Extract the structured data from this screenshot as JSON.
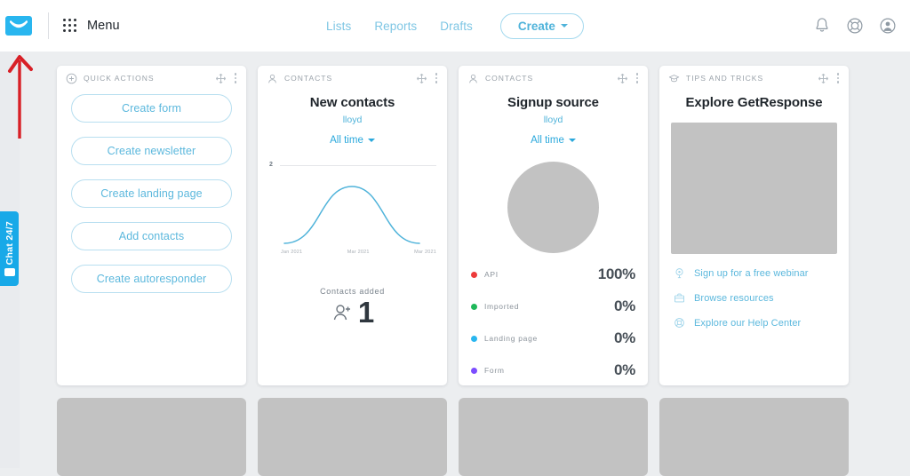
{
  "topbar": {
    "logo_icon": "envelope-icon",
    "logo_color": "#29b6ef",
    "menu_icon": "apps-grid-icon",
    "menu_label": "Menu",
    "nav_links": [
      {
        "label": "Lists"
      },
      {
        "label": "Reports"
      },
      {
        "label": "Drafts"
      }
    ],
    "create_label": "Create",
    "create_caret_icon": "chevron-down-icon",
    "right_icons": [
      {
        "name": "bell-icon"
      },
      {
        "name": "lifebuoy-icon"
      },
      {
        "name": "user-avatar-icon"
      }
    ]
  },
  "chat_widget": {
    "label": "Chat 24/7",
    "icon": "chat-bubble-icon",
    "color": "#18a9e8"
  },
  "annotation": {
    "arrow_icon": "red-up-arrow",
    "color": "#d81f26"
  },
  "cards": {
    "quick_actions": {
      "header_icon": "plus-circle-icon",
      "header_label": "Quick actions",
      "move_icon": "move-handle-icon",
      "menu_icon": "kebab-menu-icon",
      "buttons": [
        {
          "label": "Create form"
        },
        {
          "label": "Create newsletter"
        },
        {
          "label": "Create landing page"
        },
        {
          "label": "Add contacts"
        },
        {
          "label": "Create autoresponder"
        }
      ]
    },
    "new_contacts": {
      "header_icon": "contact-person-icon",
      "header_label": "Contacts",
      "move_icon": "move-handle-icon",
      "menu_icon": "kebab-menu-icon",
      "title": "New contacts",
      "subtitle": "lloyd",
      "range_label": "All time",
      "range_caret_icon": "chevron-down-icon",
      "stat_label": "Contacts added",
      "stat_value": "1",
      "stat_icon": "person-plus-icon"
    },
    "signup_source": {
      "header_icon": "contact-person-icon",
      "header_label": "Contacts",
      "move_icon": "move-handle-icon",
      "menu_icon": "kebab-menu-icon",
      "title": "Signup source",
      "subtitle": "lloyd",
      "range_label": "All time",
      "range_caret_icon": "chevron-down-icon",
      "chart_placeholder": true
    },
    "tips_and_tricks": {
      "header_icon": "graduation-cap-icon",
      "header_label": "Tips and tricks",
      "move_icon": "move-handle-icon",
      "menu_icon": "kebab-menu-icon",
      "title": "Explore GetResponse",
      "image_placeholder": true,
      "links": [
        {
          "label": "Sign up for a free webinar",
          "icon": "webinar-icon"
        },
        {
          "label": "Browse resources",
          "icon": "briefcase-icon"
        },
        {
          "label": "Explore our Help Center",
          "icon": "lifebuoy-icon"
        }
      ]
    }
  },
  "chart_data": [
    {
      "type": "line",
      "title": "New contacts",
      "subtitle": "lloyd",
      "range": "All time",
      "x": [
        "Jan 2021",
        "Mar 2021",
        "Mar 2021"
      ],
      "xlabels": [
        "Jan 2021",
        "Mar 2021",
        "Mar 2021"
      ],
      "values": [
        0,
        2,
        0
      ],
      "ylim": [
        0,
        2
      ],
      "ytick_labels": [
        "2"
      ],
      "grid": true,
      "legend": "none",
      "line_color": "#4fb3da",
      "summary_label": "Contacts added",
      "summary_value": 1
    },
    {
      "type": "pie",
      "title": "Signup source",
      "subtitle": "lloyd",
      "range": "All time",
      "categories": [
        "API",
        "Imported",
        "Landing page",
        "Form"
      ],
      "values": [
        100,
        0,
        0,
        0
      ],
      "value_labels": [
        "100%",
        "0%",
        "0%",
        "0%"
      ],
      "colors": [
        "#ed3b3b",
        "#1fb85a",
        "#29b6ef",
        "#7c4dff"
      ],
      "legend": "bottom",
      "placeholder_rendered": true
    }
  ],
  "bottom_placeholders": [
    {
      "name": "placeholder-card-1"
    },
    {
      "name": "placeholder-card-2"
    },
    {
      "name": "placeholder-card-3"
    },
    {
      "name": "placeholder-card-4"
    }
  ]
}
